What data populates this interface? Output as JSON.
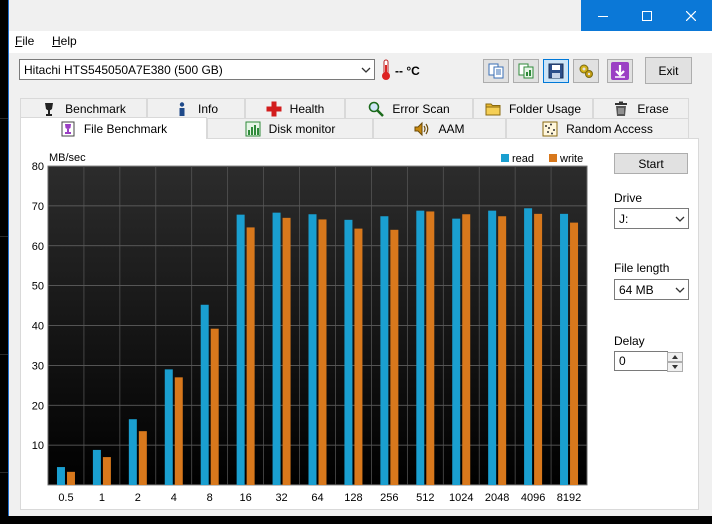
{
  "window_controls": {
    "minimize": "minimize",
    "maximize": "maximize",
    "close": "close"
  },
  "menu": {
    "file": "File",
    "help": "Help"
  },
  "drive_selector": {
    "value": "Hitachi HTS545050A7E380 (500 GB)"
  },
  "temperature": {
    "value": "-- °C"
  },
  "toolbar": {
    "buttons": [
      "copy-text-icon",
      "copy-image-icon",
      "save-icon",
      "options-icon",
      "download-icon"
    ],
    "exit_label": "Exit"
  },
  "tabs_row1": [
    {
      "label": "Benchmark",
      "icon": "benchmark-icon"
    },
    {
      "label": "Info",
      "icon": "info-icon"
    },
    {
      "label": "Health",
      "icon": "health-icon"
    },
    {
      "label": "Error Scan",
      "icon": "error-scan-icon"
    },
    {
      "label": "Folder Usage",
      "icon": "folder-icon"
    },
    {
      "label": "Erase",
      "icon": "erase-icon"
    }
  ],
  "tabs_row2": [
    {
      "label": "File Benchmark",
      "icon": "file-benchmark-icon",
      "selected": true
    },
    {
      "label": "Disk monitor",
      "icon": "disk-monitor-icon"
    },
    {
      "label": "AAM",
      "icon": "aam-icon"
    },
    {
      "label": "Random Access",
      "icon": "random-access-icon"
    }
  ],
  "side_panel": {
    "start_label": "Start",
    "drive_label": "Drive",
    "drive_value": "J:",
    "file_length_label": "File length",
    "file_length_value": "64 MB",
    "delay_label": "Delay",
    "delay_value": "0"
  },
  "colors": {
    "read": "#1a9fd0",
    "write": "#d8781c",
    "plot_bg_top": "#2b2b2b",
    "plot_bg_bottom": "#000000"
  },
  "chart_data": {
    "type": "bar",
    "ylabel": "MB/sec",
    "ylim": [
      0,
      80
    ],
    "yticks": [
      10,
      20,
      30,
      40,
      50,
      60,
      70,
      80
    ],
    "categories": [
      "0.5",
      "1",
      "2",
      "4",
      "8",
      "16",
      "32",
      "64",
      "128",
      "256",
      "512",
      "1024",
      "2048",
      "4096",
      "8192"
    ],
    "legend_position": "top-right",
    "grid": true,
    "series": [
      {
        "name": "read",
        "values": [
          4.5,
          8.8,
          16.5,
          29,
          45.2,
          67.8,
          68.3,
          67.9,
          66.5,
          67.4,
          68.8,
          66.8,
          68.8,
          69.4,
          68.0
        ]
      },
      {
        "name": "write",
        "values": [
          3.3,
          7.0,
          13.5,
          27,
          39.2,
          64.6,
          67.0,
          66.6,
          64.3,
          64.0,
          68.6,
          67.9,
          67.4,
          68.0,
          65.8
        ]
      }
    ]
  }
}
